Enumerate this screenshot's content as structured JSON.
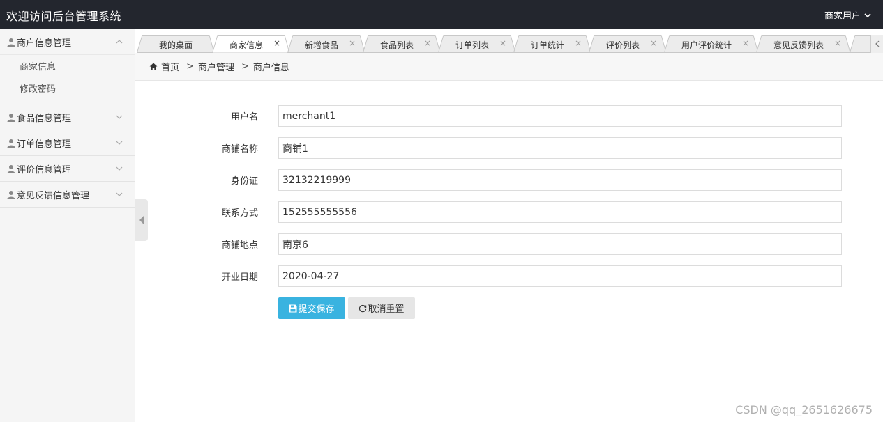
{
  "header": {
    "title": "欢迎访问后台管理系统",
    "user_label": "商家用户"
  },
  "sidebar": {
    "groups": [
      {
        "label": "商户信息管理",
        "expanded": true,
        "items": [
          "商家信息",
          "修改密码"
        ]
      },
      {
        "label": "食品信息管理",
        "expanded": false
      },
      {
        "label": "订单信息管理",
        "expanded": false
      },
      {
        "label": "评价信息管理",
        "expanded": false
      },
      {
        "label": "意见反馈信息管理",
        "expanded": false
      }
    ]
  },
  "tabs": [
    {
      "label": "我的桌面",
      "closable": false
    },
    {
      "label": "商家信息",
      "closable": true,
      "active": true
    },
    {
      "label": "新增食品",
      "closable": true
    },
    {
      "label": "食品列表",
      "closable": true
    },
    {
      "label": "订单列表",
      "closable": true
    },
    {
      "label": "订单统计",
      "closable": true
    },
    {
      "label": "评价列表",
      "closable": true
    },
    {
      "label": "用户评价统计",
      "closable": true
    },
    {
      "label": "意见反馈列表",
      "closable": true
    }
  ],
  "tab_close_glyph": "×",
  "breadcrumb": {
    "home": "首页",
    "sep": ">",
    "level1": "商户管理",
    "level2": "商户信息"
  },
  "form": {
    "fields": [
      {
        "label": "用户名",
        "value": "merchant1"
      },
      {
        "label": "商铺名称",
        "value": "商铺1"
      },
      {
        "label": "身份证",
        "value": "32132219999"
      },
      {
        "label": "联系方式",
        "value": "152555555556"
      },
      {
        "label": "商铺地点",
        "value": "南京6"
      },
      {
        "label": "开业日期",
        "value": "2020-04-27"
      }
    ],
    "save_label": "提交保存",
    "reset_label": "取消重置"
  },
  "watermark": "CSDN @qq_2651626675",
  "colors": {
    "header_bg": "#23262e",
    "primary": "#39b3e0",
    "sidebar_bg": "#f5f5f5"
  }
}
